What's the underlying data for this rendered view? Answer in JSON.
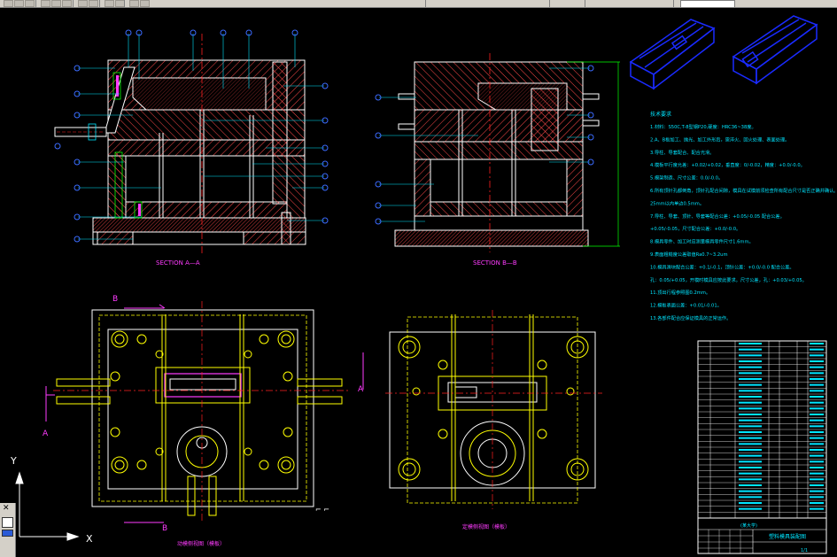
{
  "colors": {
    "background": "#000000",
    "outline": "#ffffff",
    "hatch": "#ff4040",
    "centerline": "#ff2020",
    "leader": "#00e5ff",
    "balloon": "#3b6bff",
    "yellow": "#ffff00",
    "magenta": "#ff3bff",
    "green": "#00ff00",
    "solid_blue": "#1a2bff"
  },
  "toolbar": {
    "icons": [
      "open-icon",
      "save-icon",
      "print-icon",
      "cut-icon",
      "copy-icon",
      "paste-icon",
      "undo-icon",
      "redo-icon",
      "pan-icon",
      "zoom-icon",
      "properties-icon",
      "layer-icon"
    ]
  },
  "views": {
    "section_a_label": "SECTION A—A",
    "section_b_label": "SECTION B—B",
    "moving_plate_label": "动模侧视图（模板）",
    "fixed_plate_label": "定模侧视图（模板）",
    "cut_mark_a": "A",
    "cut_mark_b": "B"
  },
  "ucs": {
    "x_label": "X",
    "y_label": "Y"
  },
  "notes": {
    "title": "技术要求",
    "lines": [
      "1.材料：S50C,T-8型钢P20,硬度：HRC36~38度。",
      "2.A、B板加工、抛光、加工外形后，需淬火、回火处理、表面处理。",
      "3.导柱、导套配合、配合光滑。",
      "4.模板平行度允差：+0.02/+0.02，垂直度：0/-0.02，精度：+0.0/-0.0。",
      "5.模架制造、尺寸公差：0.0/-0.0。",
      "6.所有顶针孔都倒角，顶针孔配合间隙，模具在试模前须检查所有配合尺寸是否正确并确认。",
      "  25mm以内单边0.5mm。",
      "7.导柱、导套、顶针、导套等配合公差：+0.05/-0.05 配合公差。",
      "  +0.05/-0.05，尺寸配合公差：+0.0/-0.0。",
      "8.模具零件、加工时应测量模具零件尺寸1.6mm。",
      "9.表面粗糙度公差取值Ra0.7~3.2um",
      "10.模具滑块配合公差：+0.1/-0.1，顶针公差：+0.0/-0.0 配合公差。",
      "   孔：0.05/+0.05，开模时模具应按此要求。尺寸公差，孔：+0.03/+0.05。",
      "11.顶出行程参照图0.2mm。",
      "12.模板表面公差：+0.01/-0.01。",
      "13.各部件配合应保证模具的正常运作。"
    ]
  },
  "title_block": {
    "school": "(某大学)",
    "drawing_title": "塑料模具装配图",
    "sheet": "1/1"
  },
  "bom": {
    "rows": 30
  }
}
